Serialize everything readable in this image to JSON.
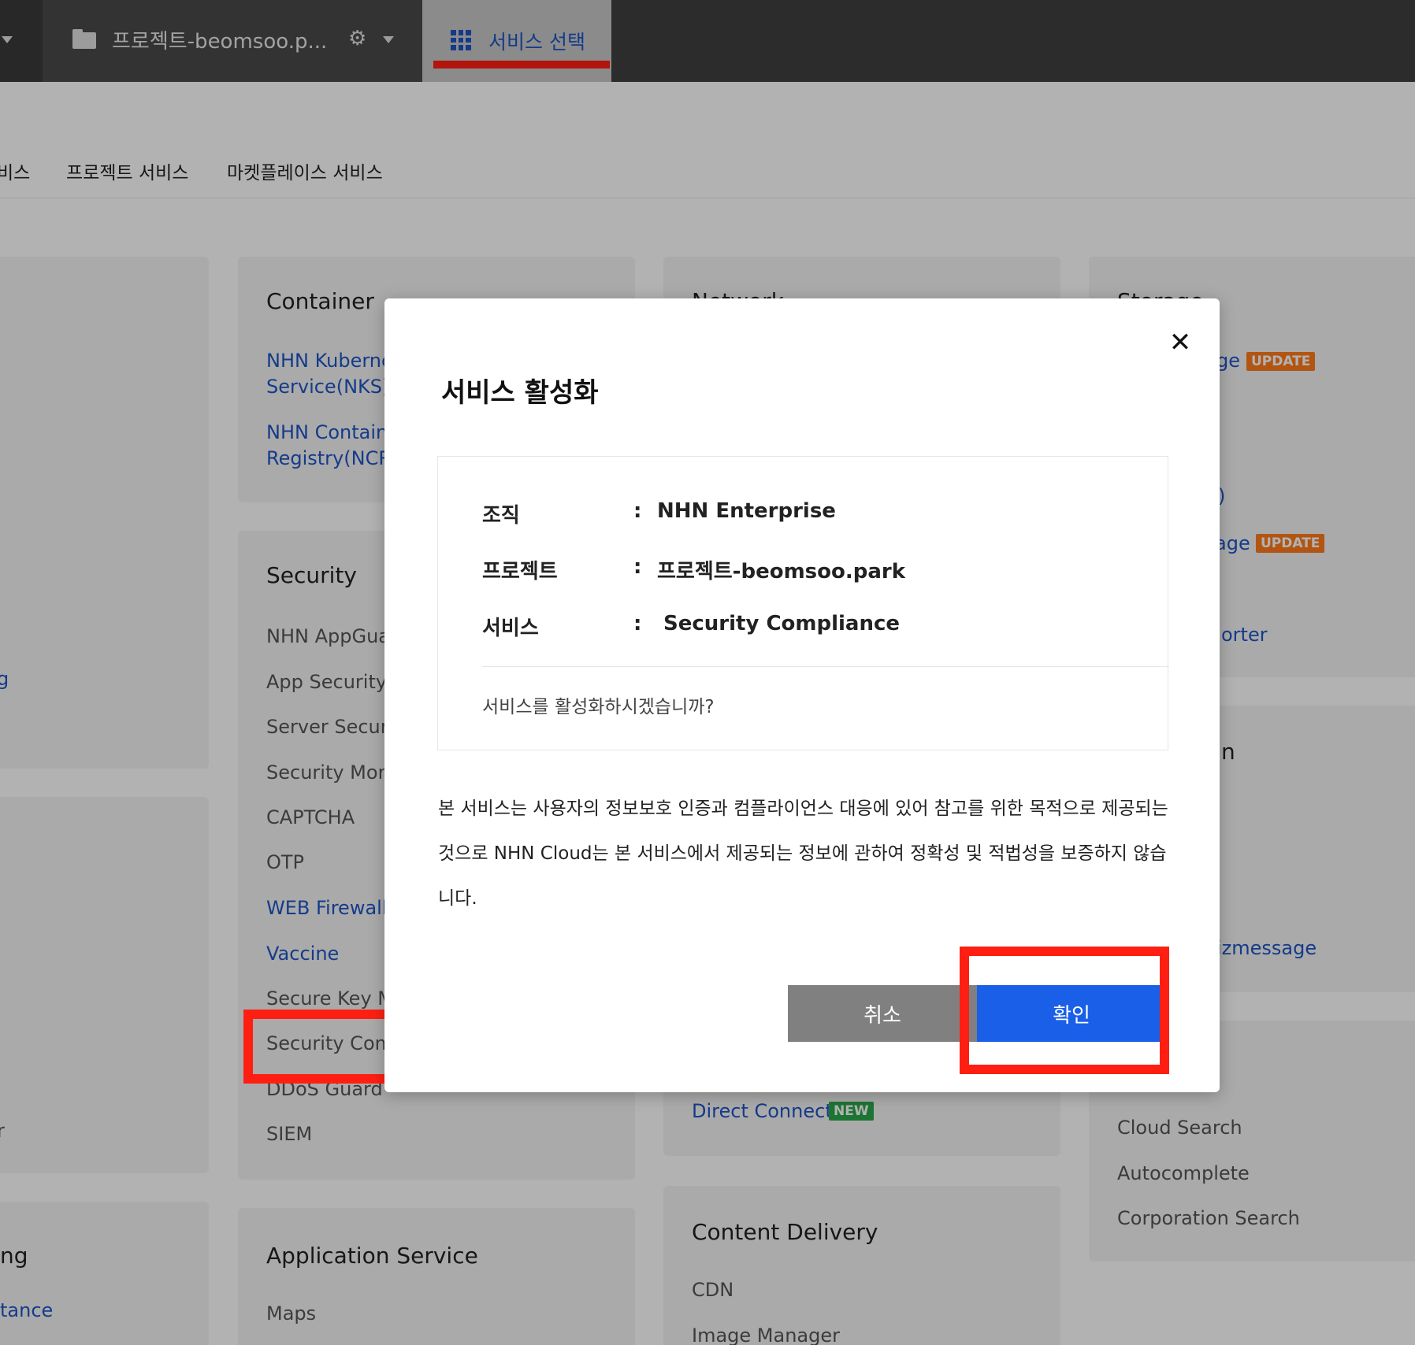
{
  "topbar": {
    "project_name": "프로젝트-beomsoo.p...",
    "gear_glyph": "⚙",
    "service_tab_label": "서비스 선택"
  },
  "subnav": {
    "items": [
      "비스",
      "프로젝트 서비스",
      "마켓플레이스 서비스"
    ]
  },
  "cards": {
    "container": {
      "title": "Container",
      "items": [
        "NHN Kuberne",
        "Service(NKS)",
        "NHN Containe",
        "Registry(NCR)"
      ]
    },
    "security": {
      "title": "Security",
      "items": [
        "NHN AppGuar",
        "App Security C",
        "Server Securit",
        "Security Moni",
        "CAPTCHA",
        "OTP",
        "WEB Firewall",
        "Vaccine",
        "Secure Key Ma",
        "Security Comp",
        "DDoS Guard",
        "SIEM"
      ]
    },
    "application_service": {
      "title": "Application Service",
      "items": [
        "Maps"
      ]
    },
    "network": {
      "title_fragment": "Network",
      "direct_connect": "Direct Connect",
      "new_badge": "NEW"
    },
    "content_delivery": {
      "title": "Content Delivery",
      "items": [
        "CDN",
        "Image Manager"
      ]
    },
    "storage": {
      "title_fragment": "Storage",
      "item1_fragment": "ge",
      "item2_fragment": ")",
      "item3_fragment": "age",
      "item4_fragment": "orter",
      "update_badge": "UPDATE"
    },
    "notification": {
      "title_fragment": "n",
      "item_fragment": "izmessage"
    },
    "search": {
      "items": [
        "Cloud Search",
        "Autocomplete",
        "Corporation Search"
      ]
    },
    "left_column": {
      "fragment1": "g",
      "fragment2": "r",
      "fragment3": "ng",
      "fragment4": "tance"
    }
  },
  "modal": {
    "close_glyph": "✕",
    "title": "서비스 활성화",
    "rows": [
      {
        "key": "조직",
        "value": "NHN Enterprise"
      },
      {
        "key": "프로젝트",
        "value": "프로젝트-beomsoo.park"
      },
      {
        "key": "서비스",
        "value": "Security Compliance"
      }
    ],
    "colon": ":",
    "question": "서비스를 활성화하시겠습니까?",
    "notice": "본 서비스는 사용자의 정보보호 인증과 컴플라이언스 대응에 있어 참고를 위한 목적으로 제공되는 것으로 NHN Cloud는 본 서비스에서 제공되는 정보에 관하여 정확성 및 적법성을 보증하지 않습니다.",
    "cancel_label": "취소",
    "confirm_label": "확인"
  },
  "colors": {
    "accent_blue": "#1a5fe8",
    "link_blue": "#1e55c6",
    "highlight_red": "#ff1f12",
    "update_orange": "#ff7a1a",
    "new_green": "#2aa84a"
  }
}
